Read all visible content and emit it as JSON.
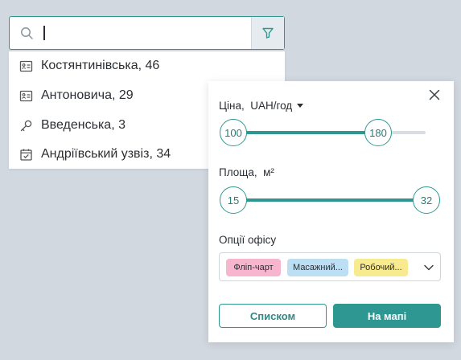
{
  "search": {
    "value": "",
    "placeholder": ""
  },
  "results": [
    {
      "icon": "id-card-icon",
      "label": "Костянтинівська, 46"
    },
    {
      "icon": "id-card-icon",
      "label": "Антоновича, 29"
    },
    {
      "icon": "key-icon",
      "label": "Введенська, 3"
    },
    {
      "icon": "calendar-check-icon",
      "label": "Андріївський узвіз, 34"
    }
  ],
  "filters": {
    "price": {
      "label": "Ціна,",
      "unit": "UAH/год",
      "min": "100",
      "max": "180"
    },
    "area": {
      "label": "Площа,",
      "unit": "м²",
      "min": "15",
      "max": "32"
    },
    "options": {
      "label": "Опції офісу",
      "chips": [
        "Фліп-чарт",
        "Масажний...",
        "Робочий..."
      ]
    },
    "list_button": "Списком",
    "map_button": "На мапі"
  },
  "colors": {
    "accent": "#2f9791",
    "chip_pink": "#f7b6ce",
    "chip_blue": "#bddff4",
    "chip_yellow": "#f8ea8e"
  }
}
